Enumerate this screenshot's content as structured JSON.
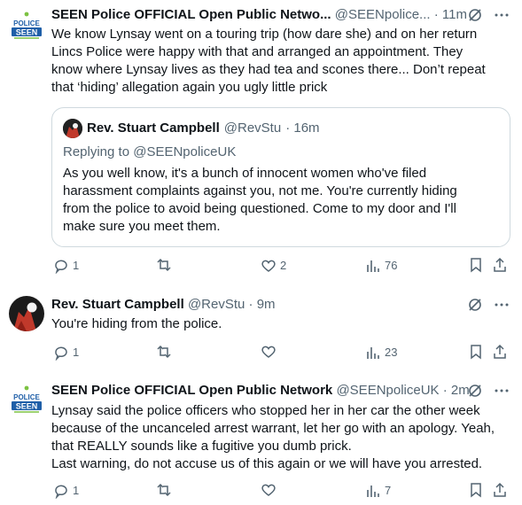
{
  "tweets": [
    {
      "name": "SEEN Police OFFICIAL Open Public Netwo...",
      "handle": "@SEENpolice...",
      "time": "· 11m",
      "text": "We know Lynsay went on a touring trip (how dare she) and on her return\nLincs Police were happy with that and arranged an appointment. They\nknow where Lynsay lives as they had tea and scones there... Don’t repeat\nthat ‘hiding’ allegation again you ugly little prick",
      "avatar_text_top": "POLICE",
      "avatar_text_bottom": "SEEN",
      "quote": {
        "name": "Rev. Stuart Campbell",
        "handle": "@RevStu",
        "time": "· 16m",
        "reply_prefix": "Replying to",
        "reply_handle": "@SEENpoliceUK",
        "text": "As you well know, it's a bunch of innocent women who've filed\nharassment complaints against you, not me. You're currently hiding\nfrom the police to avoid being questioned. Come to my door and I'll\nmake sure you meet them."
      },
      "stats": {
        "replies": "1",
        "retweets": "",
        "likes": "2",
        "views": "76"
      }
    },
    {
      "name": "Rev. Stuart Campbell",
      "handle": "@RevStu",
      "time": "· 9m",
      "text": "You're hiding from the police.",
      "stats": {
        "replies": "1",
        "retweets": "",
        "likes": "",
        "views": "23"
      }
    },
    {
      "name": "SEEN Police OFFICIAL Open Public Network",
      "handle": "@SEENpoliceUK",
      "time": "· 2m",
      "text": "Lynsay said the police officers who stopped her in her car the other week\nbecause of the uncanceled arrest warrant, let her go with an apology. Yeah,\nthat REALLY sounds like a fugitive you dumb prick.\nLast warning, do not accuse us of this again or we will have you arrested.",
      "avatar_text_top": "POLICE",
      "avatar_text_bottom": "SEEN",
      "stats": {
        "replies": "1",
        "retweets": "",
        "likes": "",
        "views": "7"
      }
    }
  ],
  "colors": {
    "text": "#0f1419",
    "muted": "#536471",
    "border": "#cfd9de",
    "seen_blue": "#1f5fa8",
    "seen_green": "#7cc242"
  },
  "icons": [
    "grok-slash-icon",
    "more-icon",
    "reply-icon",
    "retweet-icon",
    "like-icon",
    "views-icon",
    "bookmark-icon",
    "share-icon"
  ]
}
